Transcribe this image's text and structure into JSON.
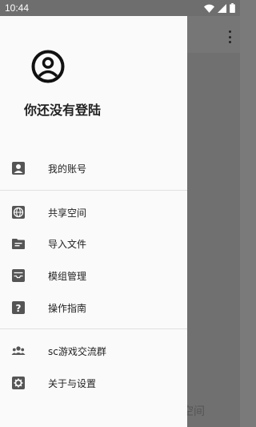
{
  "status_bar": {
    "time": "10:44"
  },
  "drawer": {
    "title": "你还没有登陆",
    "items": [
      {
        "label": "我的账号",
        "icon": "account-box-icon"
      },
      {
        "label": "共享空间",
        "icon": "globe-icon"
      },
      {
        "label": "导入文件",
        "icon": "folder-icon"
      },
      {
        "label": "模组管理",
        "icon": "inbox-tray-icon"
      },
      {
        "label": "操作指南",
        "icon": "help-icon"
      },
      {
        "label": "sc游戏交流群",
        "icon": "group-icon"
      },
      {
        "label": "关于与设置",
        "icon": "gear-icon"
      }
    ]
  },
  "background": {
    "partial_text": "空间"
  }
}
